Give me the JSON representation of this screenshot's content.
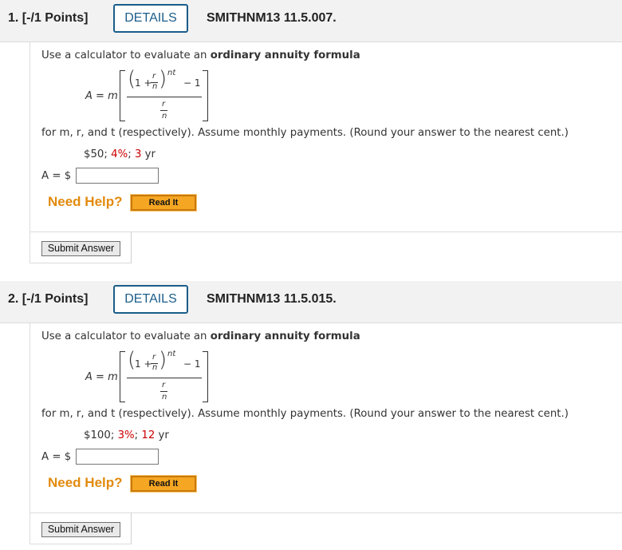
{
  "questions": [
    {
      "number": "1.  [-/1 Points]",
      "details_label": "DETAILS",
      "id": "SMITHNM13 11.5.007.",
      "prompt_pre": "Use a calculator to evaluate an ",
      "prompt_bold": "ordinary annuity formula",
      "formula": {
        "lhs_var": "A",
        "eq": " = ",
        "m": "m",
        "one_plus": "1 + ",
        "r": "r",
        "n": "n",
        "nt": "nt",
        "minus_one": "− 1"
      },
      "instructions": "for m, r, and t (respectively). Assume monthly payments. (Round your answer to the nearest cent.)",
      "value_m": "$50;",
      "value_r": "4%",
      "value_t_num": "3",
      "value_t_unit": "yr",
      "answer_label": "A = $",
      "answer_value": "",
      "need_help": "Need Help?",
      "read_it": "Read It",
      "submit": "Submit Answer"
    },
    {
      "number": "2.  [-/1 Points]",
      "details_label": "DETAILS",
      "id": "SMITHNM13 11.5.015.",
      "prompt_pre": "Use a calculator to evaluate an ",
      "prompt_bold": "ordinary annuity formula",
      "formula": {
        "lhs_var": "A",
        "eq": " = ",
        "m": "m",
        "one_plus": "1 + ",
        "r": "r",
        "n": "n",
        "nt": "nt",
        "minus_one": "− 1"
      },
      "instructions": "for m, r, and t (respectively). Assume monthly payments. (Round your answer to the nearest cent.)",
      "value_m": "$100;",
      "value_r": "3%",
      "value_t_num": "12",
      "value_t_unit": "yr",
      "answer_label": "A = $",
      "answer_value": "",
      "need_help": "Need Help?",
      "read_it": "Read It",
      "submit": "Submit Answer"
    }
  ],
  "colors": {
    "accent": "#1a5d8a",
    "help": "#e28a0e",
    "value_red": "#cc0000",
    "readit_bg": "#f5a623"
  }
}
